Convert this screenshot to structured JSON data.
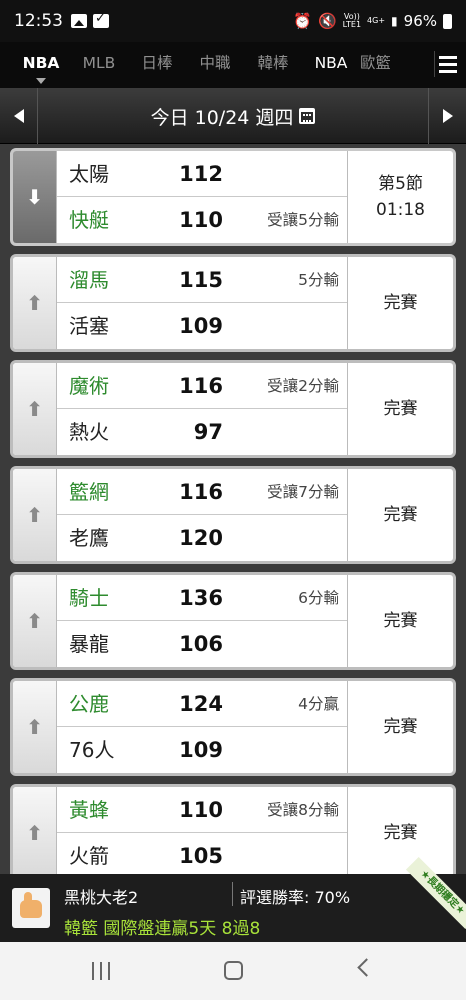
{
  "status_bar": {
    "time": "12:53",
    "left_icons": [
      "image-icon",
      "check-icon"
    ],
    "right_icons": [
      "alarm-icon",
      "mute-icon"
    ],
    "volte_label": "Vo))\nLTE1",
    "network_label": "4G+",
    "battery": "96%"
  },
  "league_tabs": [
    {
      "label": "NBA",
      "active": true
    },
    {
      "label": "MLB",
      "active": false
    },
    {
      "label": "日棒",
      "active": false
    },
    {
      "label": "中職",
      "active": false
    },
    {
      "label": "韓棒",
      "active": false
    },
    {
      "label": "NBA",
      "active": false
    },
    {
      "label": "歐籃",
      "active": false
    }
  ],
  "date_bar": {
    "label": "今日 10/24 週四"
  },
  "games": [
    {
      "state": "live",
      "team1": {
        "name": "太陽",
        "score": "112",
        "spread": "",
        "highlight": false
      },
      "team2": {
        "name": "快艇",
        "score": "110",
        "spread": "受讓5分輸",
        "highlight": true
      },
      "status_line1": "第5節",
      "status_line2": "01:18"
    },
    {
      "state": "final",
      "team1": {
        "name": "溜馬",
        "score": "115",
        "spread": "5分輸",
        "highlight": true
      },
      "team2": {
        "name": "活塞",
        "score": "109",
        "spread": "",
        "highlight": false
      },
      "status_line1": "完賽",
      "status_line2": ""
    },
    {
      "state": "final",
      "team1": {
        "name": "魔術",
        "score": "116",
        "spread": "受讓2分輸",
        "highlight": true
      },
      "team2": {
        "name": "熱火",
        "score": "97",
        "spread": "",
        "highlight": false
      },
      "status_line1": "完賽",
      "status_line2": ""
    },
    {
      "state": "final",
      "team1": {
        "name": "籃網",
        "score": "116",
        "spread": "受讓7分輸",
        "highlight": true
      },
      "team2": {
        "name": "老鷹",
        "score": "120",
        "spread": "",
        "highlight": false
      },
      "status_line1": "完賽",
      "status_line2": ""
    },
    {
      "state": "final",
      "team1": {
        "name": "騎士",
        "score": "136",
        "spread": "6分輸",
        "highlight": true
      },
      "team2": {
        "name": "暴龍",
        "score": "106",
        "spread": "",
        "highlight": false
      },
      "status_line1": "完賽",
      "status_line2": ""
    },
    {
      "state": "final",
      "team1": {
        "name": "公鹿",
        "score": "124",
        "spread": "4分贏",
        "highlight": true
      },
      "team2": {
        "name": "76人",
        "score": "109",
        "spread": "",
        "highlight": false
      },
      "status_line1": "完賽",
      "status_line2": ""
    },
    {
      "state": "final",
      "team1": {
        "name": "黃蜂",
        "score": "110",
        "spread": "受讓8分輸",
        "highlight": true
      },
      "team2": {
        "name": "火箭",
        "score": "105",
        "spread": "",
        "highlight": false
      },
      "status_line1": "完賽",
      "status_line2": ""
    }
  ],
  "banner": {
    "user_name": "黑桃大老2",
    "win_rate": "評選勝率: 70%",
    "promo": "韓籃 國際盤連贏5天 8過8",
    "ribbon": "★長期穩定★"
  },
  "colors": {
    "favorite_team": "#2e8b2e",
    "promo_text": "#a8e23a",
    "background": "#3a3a3a"
  }
}
